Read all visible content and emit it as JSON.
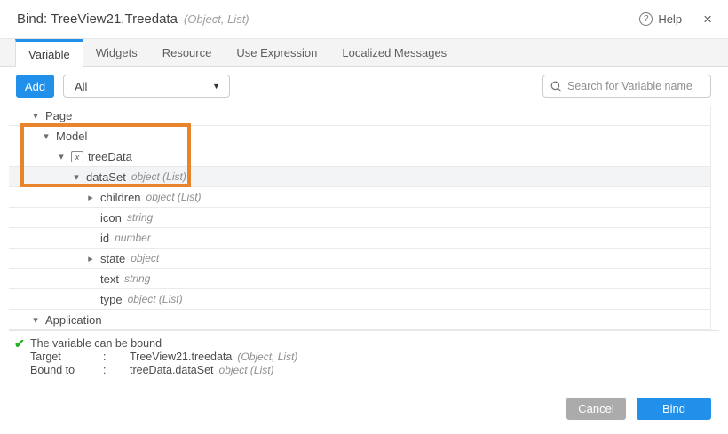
{
  "dialog": {
    "title": "Bind: TreeView21.Treedata",
    "title_suffix": "(Object, List)",
    "help_label": "Help",
    "help_glyph": "?",
    "close_glyph": "×"
  },
  "tabs": [
    {
      "label": "Variable",
      "active": true
    },
    {
      "label": "Widgets",
      "active": false
    },
    {
      "label": "Resource",
      "active": false
    },
    {
      "label": "Use Expression",
      "active": false
    },
    {
      "label": "Localized Messages",
      "active": false
    }
  ],
  "toolbar": {
    "add_label": "Add",
    "filter_value": "All",
    "search_placeholder": "Search for Variable name"
  },
  "tree": {
    "rows": [
      {
        "label": "Page",
        "type": "",
        "indent": 0,
        "caret": "down",
        "icon": "",
        "selected": false
      },
      {
        "label": "Model",
        "type": "",
        "indent": 1,
        "caret": "down",
        "icon": "",
        "selected": false
      },
      {
        "label": "treeData",
        "type": "",
        "indent": 2,
        "caret": "down",
        "icon": "variable",
        "selected": false
      },
      {
        "label": "dataSet",
        "type": "object (List)",
        "indent": 3,
        "caret": "down",
        "icon": "",
        "selected": true
      },
      {
        "label": "children",
        "type": "object (List)",
        "indent": 4,
        "caret": "right",
        "icon": "",
        "selected": false
      },
      {
        "label": "icon",
        "type": "string",
        "indent": 4,
        "caret": "none",
        "icon": "",
        "selected": false
      },
      {
        "label": "id",
        "type": "number",
        "indent": 4,
        "caret": "none",
        "icon": "",
        "selected": false
      },
      {
        "label": "state",
        "type": "object",
        "indent": 4,
        "caret": "right",
        "icon": "",
        "selected": false
      },
      {
        "label": "text",
        "type": "string",
        "indent": 4,
        "caret": "none",
        "icon": "",
        "selected": false
      },
      {
        "label": "type",
        "type": "object (List)",
        "indent": 4,
        "caret": "none",
        "icon": "",
        "selected": false
      },
      {
        "label": "Application",
        "type": "",
        "indent": 0,
        "caret": "down",
        "icon": "",
        "selected": false
      }
    ]
  },
  "status": {
    "message": "The variable can be bound",
    "check_glyph": "✔",
    "target_label": "Target",
    "colon": ":",
    "target_value": "TreeView21.treedata",
    "target_type": "(Object, List)",
    "bound_label": "Bound to",
    "bound_value": "treeData.dataSet",
    "bound_type": "object (List)"
  },
  "footer": {
    "cancel_label": "Cancel",
    "bind_label": "Bind"
  },
  "colors": {
    "accent_blue": "#2090ea",
    "highlight_orange": "#e8842c",
    "success_green": "#23b223",
    "cancel_gray": "#ababab",
    "selected_row_bg": "#f3f4f6"
  }
}
